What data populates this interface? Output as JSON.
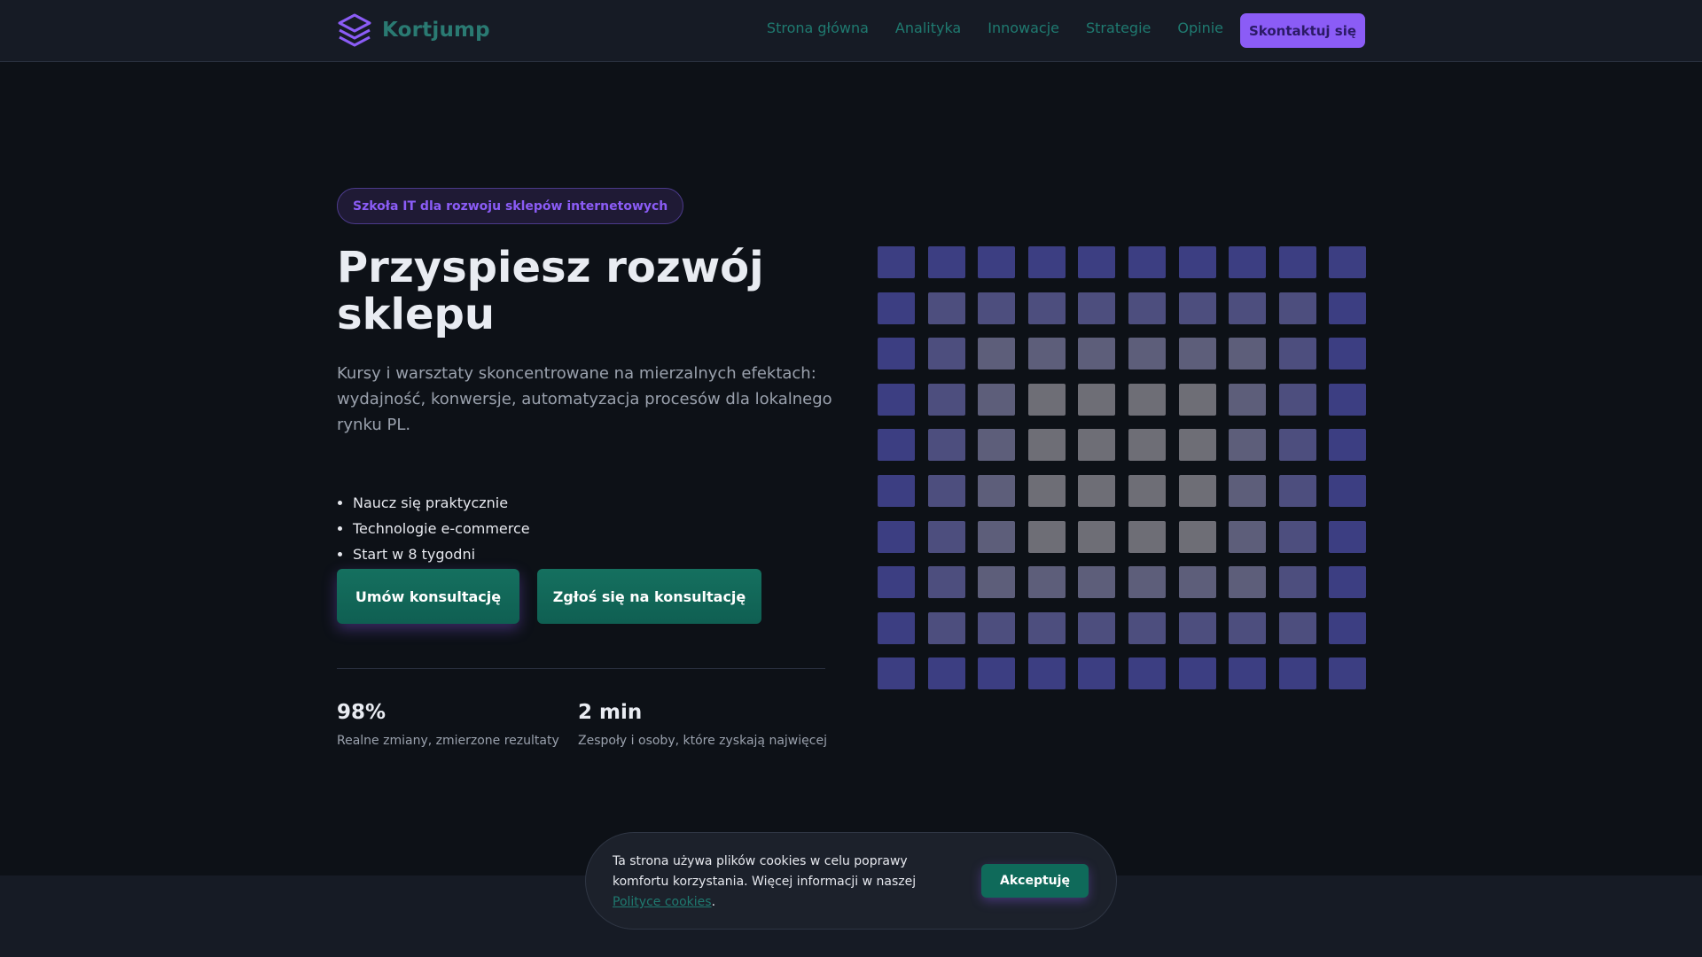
{
  "colors": {
    "accent": "#8b5cf6",
    "brand": "#1f7a70",
    "button": "#0f6a5a",
    "background": "#0d1117"
  },
  "header": {
    "logo_icon": "stacked-layers-icon",
    "logo_text": "Kortjump",
    "nav": [
      "Strona główna",
      "Analityka",
      "Innowacje",
      "Strategie",
      "Opinie"
    ],
    "cta_label": "Skontaktuj się"
  },
  "hero": {
    "badge": "Szkoła IT dla rozwoju sklepów internetowych",
    "title": "Przyspiesz rozwój sklepu",
    "subtitle": "Kursy i warsztaty skoncentrowane na mierzalnych efektach: wydajność, konwersje, automatyzacja procesów dla lokalnego rynku PL.",
    "features": [
      "Naucz się praktycznie",
      "Technologie e-commerce",
      "Start w 8 tygodni"
    ],
    "primary_button": "Umów konsultację",
    "secondary_button": "Zgłoś się na konsultację"
  },
  "stats": [
    {
      "value": "98%",
      "label": "Realne zmiany, zmierzone rezultaty"
    },
    {
      "value": "2 min",
      "label": "Zespoły i osoby, które zyskają najwięcej"
    }
  ],
  "cookie": {
    "text_before": "Ta strona używa plików cookies w celu poprawy komfortu korzystania. Więcej informacji w naszej ",
    "link": "Polityce cookies",
    "text_after": ".",
    "accept_button": "Akceptuję"
  }
}
